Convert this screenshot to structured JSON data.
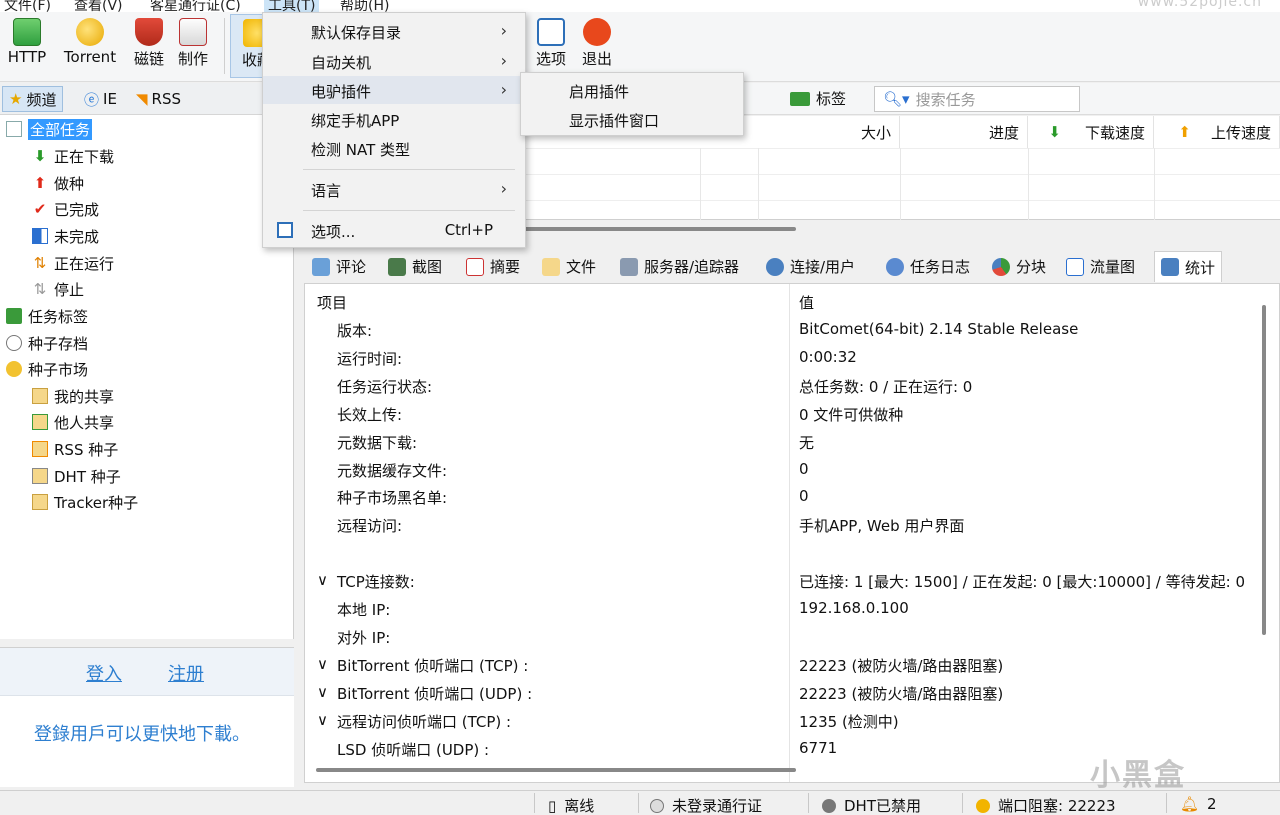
{
  "menubar": {
    "items": [
      "文件(F)",
      "查看(V)",
      "客星通行证(C)",
      "工具(T)",
      "帮助(H)"
    ],
    "watermark": "www.52pojie.cn"
  },
  "toolbar": {
    "http": "HTTP",
    "torrent": "Torrent",
    "magnet": "磁链",
    "make": "制作",
    "collect": "收藏",
    "options": "选项",
    "exit": "退出"
  },
  "left": {
    "tabs": [
      "频道",
      "IE",
      "RSS"
    ],
    "tree": {
      "all_tasks": "全部任务",
      "downloading": "正在下载",
      "seeding": "做种",
      "completed": "已完成",
      "incomplete": "未完成",
      "running": "正在运行",
      "stopped": "停止",
      "task_tags": "任务标签",
      "torrent_archive": "种子存档",
      "torrent_market": "种子市场",
      "my_share": "我的共享",
      "others_share": "他人共享",
      "rss_torrent": "RSS 种子",
      "dht_torrent": "DHT 种子",
      "tracker_torrent": "Tracker种子"
    },
    "login": {
      "login": "登入",
      "register": "注册",
      "message": "登錄用戶可以更快地下載。"
    }
  },
  "tasklist": {
    "tag_label": "标签",
    "search_placeholder": "搜索任务",
    "columns": {
      "size": "大小",
      "progress": "进度",
      "down_speed": "下载速度",
      "up_speed": "上传速度"
    }
  },
  "tools_menu": {
    "items": {
      "default_dir": "默认保存目录",
      "auto_shutdown": "自动关机",
      "emule_plugin": "电驴插件",
      "bind_app": "绑定手机APP",
      "detect_nat": "检测 NAT 类型",
      "language": "语言",
      "options": "选项...",
      "options_shortcut": "Ctrl+P"
    },
    "submenu": {
      "enable_plugin": "启用插件",
      "show_plugin_window": "显示插件窗口"
    }
  },
  "detail_tabs": [
    "评论",
    "截图",
    "摘要",
    "文件",
    "服务器/追踪器",
    "连接/用户",
    "任务日志",
    "分块",
    "流量图",
    "统计"
  ],
  "stats": {
    "header_key": "项目",
    "header_value": "值",
    "rows": [
      {
        "k": "版本:",
        "v": "BitComet(64-bit) 2.14 Stable Release"
      },
      {
        "k": "运行时间:",
        "v": "0:00:32"
      },
      {
        "k": "任务运行状态:",
        "v": "总任务数: 0 / 正在运行: 0"
      },
      {
        "k": "长效上传:",
        "v": "0 文件可供做种"
      },
      {
        "k": "元数据下载:",
        "v": "无"
      },
      {
        "k": "元数据缓存文件:",
        "v": "0"
      },
      {
        "k": "种子市场黑名单:",
        "v": "0"
      },
      {
        "k": "远程访问:",
        "v": "手机APP, Web 用户界面"
      },
      {
        "k": "",
        "v": ""
      },
      {
        "k": "TCP连接数:",
        "v": "已连接: 1 [最大: 1500] / 正在发起: 0 [最大:10000] / 等待发起: 0"
      },
      {
        "k": "本地 IP:",
        "v": "192.168.0.100"
      },
      {
        "k": "对外 IP:",
        "v": ""
      },
      {
        "k": "BitTorrent 侦听端口 (TCP) :",
        "v": "22223 (被防火墙/路由器阻塞)"
      },
      {
        "k": "BitTorrent 侦听端口  (UDP) :",
        "v": "22223 (被防火墙/路由器阻塞)"
      },
      {
        "k": "远程访问侦听端口  (TCP) :",
        "v": "1235 (检测中)"
      },
      {
        "k": "LSD 侦听端口  (UDP) :",
        "v": "6771"
      }
    ]
  },
  "statusbar": {
    "offline": "离线",
    "passport": "未登录通行证",
    "dht": "DHT已禁用",
    "port": "端口阻塞:  22223",
    "count": "2"
  },
  "watermark_logo": "小黑盒",
  "colors": {
    "accent": "#3399ff",
    "link": "#2e7fd0"
  }
}
